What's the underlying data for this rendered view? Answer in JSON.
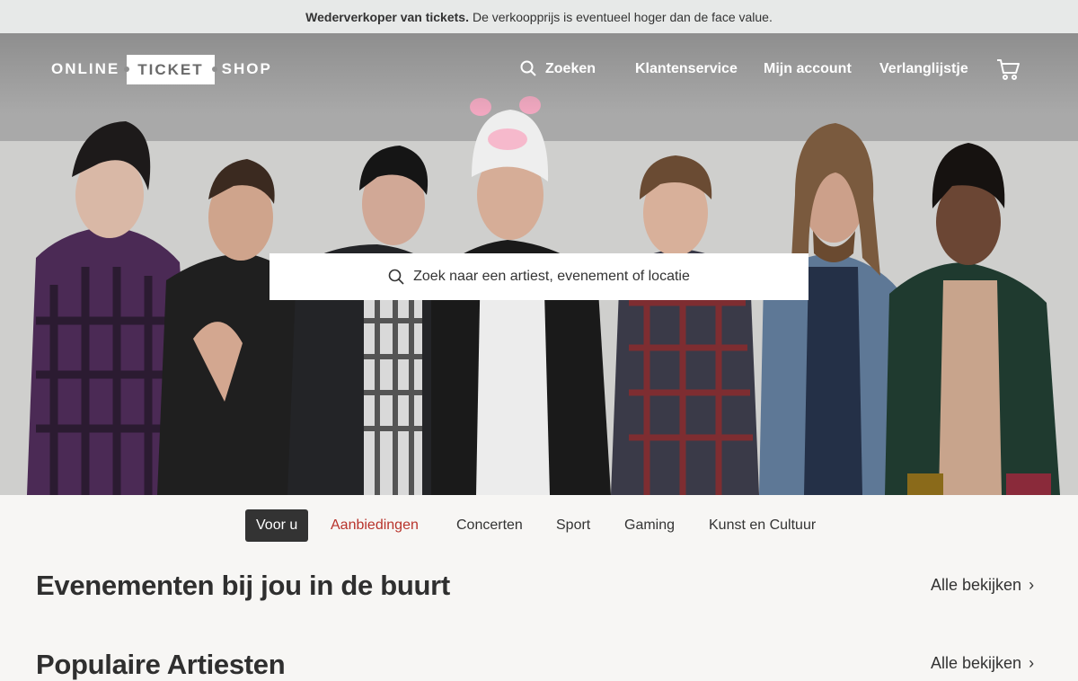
{
  "notice": {
    "bold": "Wederverkoper van tickets.",
    "text": "De verkoopprijs is eventueel hoger dan de face value."
  },
  "logo": {
    "left": "ONLINE",
    "mid": "TICKET",
    "right": "SHOP"
  },
  "nav": {
    "search": "Zoeken",
    "service": "Klantenservice",
    "account": "Mijn account",
    "wishlist": "Verlanglijstje"
  },
  "hero": {
    "search_placeholder": "Zoek naar een artiest, evenement of locatie"
  },
  "categories": [
    "Voor u",
    "Aanbiedingen",
    "Concerten",
    "Sport",
    "Gaming",
    "Kunst en Cultuur"
  ],
  "sections": [
    {
      "title": "Evenementen bij jou in de buurt",
      "link": "Alle bekijken"
    },
    {
      "title": "Populaire Artiesten",
      "link": "Alle bekijken"
    }
  ],
  "icons": {
    "search": "search-icon",
    "cart": "cart-icon",
    "chevron": "chevron-right-icon"
  },
  "colors": {
    "notice_bg": "#e7e9e8",
    "accent_deal": "#b8332b",
    "active_tab": "#333333",
    "page_bg": "#f7f6f4"
  }
}
